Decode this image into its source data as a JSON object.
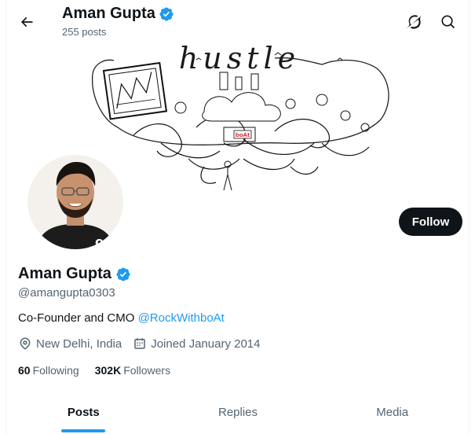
{
  "header": {
    "name": "Aman Gupta",
    "posts_count": "255 posts",
    "back_icon": "arrow-left-icon",
    "grok_icon": "grok-icon",
    "search_icon": "search-icon"
  },
  "banner": {
    "text": "hustle",
    "image": "hustle-doodle-illustration"
  },
  "profile": {
    "name": "Aman Gupta",
    "verified": true,
    "handle": "@amangupta0303",
    "bio_text": "Co-Founder and CMO ",
    "bio_link": "@RockWithboAt",
    "location": "New Delhi, India",
    "joined": "Joined January 2014",
    "following_count": "60",
    "following_label": "Following",
    "followers_count": "302K",
    "followers_label": "Followers"
  },
  "actions": {
    "follow_label": "Follow"
  },
  "tabs": [
    {
      "label": "Posts",
      "active": true
    },
    {
      "label": "Replies",
      "active": false
    },
    {
      "label": "Media",
      "active": false
    }
  ],
  "colors": {
    "accent": "#1d9bf0",
    "text_primary": "#0f1419",
    "text_secondary": "#536471",
    "button_bg": "#0f1419"
  }
}
